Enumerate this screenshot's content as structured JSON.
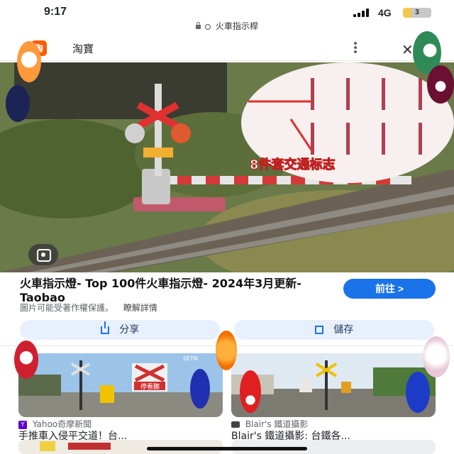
{
  "status": {
    "time": "9:17",
    "network": "4G",
    "battery": "3",
    "battery_level": 0.3
  },
  "url_bar": {
    "text": "火車指示桿"
  },
  "site_header": {
    "favicon_text": "淘",
    "site_name": "淘寶"
  },
  "hero": {
    "banner_text": "8件套交通标志"
  },
  "result": {
    "title": "火車指示燈- Top 100件火車指示燈- 2024年3月更新- Taobao",
    "visit_label": "前往 >",
    "copyright": "圖片可能受著作權保護。",
    "learn_more": "瞭解詳情"
  },
  "actions": {
    "share_label": "分享",
    "save_label": "儲存"
  },
  "related": [
    {
      "source_icon": "Y",
      "source": "Yahoo奇摩新聞",
      "title": "手推車入侵平交道！台..."
    },
    {
      "source": "Blair's 鐵道攝影",
      "title": "Blair's 鐵道攝影: 台鐵各..."
    }
  ],
  "card_image_text": {
    "left_sign": "停看聽",
    "left_logo": "SETN"
  },
  "colors": {
    "accent": "#1a73e8",
    "action_bg": "#e8f0fe",
    "taobao_orange": "#ff5a00"
  },
  "icons": [
    "lock-icon",
    "search-icon",
    "more-icon",
    "close-icon",
    "lens-icon",
    "share-icon",
    "bookmark-icon",
    "yahoo-icon",
    "camera-icon"
  ]
}
